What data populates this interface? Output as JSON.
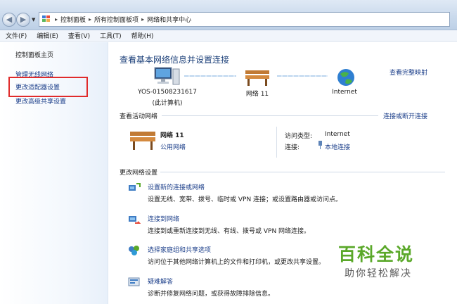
{
  "breadcrumb": {
    "items": [
      "控制面板",
      "所有控制面板项",
      "网络和共享中心"
    ],
    "icon": "control-panel-icon"
  },
  "menu": [
    "文件(F)",
    "编辑(E)",
    "查看(V)",
    "工具(T)",
    "帮助(H)"
  ],
  "sidebar": {
    "home": "控制面板主页",
    "items": [
      "管理无线网络",
      "更改适配器设置",
      "更改高级共享设置"
    ],
    "highlighted": "更改适配器设置",
    "highlight_color": "#e02b2b"
  },
  "main": {
    "title": "查看基本网络信息并设置连接",
    "full_map_link": "查看完整映射",
    "map": {
      "computer_name": "YOS-01508231617",
      "computer_sub": "(此计算机)",
      "network_name": "网络  11",
      "internet": "Internet"
    },
    "active_networks": {
      "heading": "查看活动网络",
      "disconnect_link": "连接或断开连接",
      "name": "网络  11",
      "type": "公用网络",
      "access_type_label": "访问类型:",
      "access_type_value": "Internet",
      "connections_label": "连接:",
      "connections_value": "本地连接"
    },
    "change_settings": {
      "heading": "更改网络设置",
      "tasks": [
        {
          "link": "设置新的连接或网络",
          "desc": "设置无线、宽带、拨号、临时或 VPN 连接；或设置路由器或访问点。"
        },
        {
          "link": "连接到网络",
          "desc": "连接到或重新连接到无线、有线、拨号或 VPN 网络连接。"
        },
        {
          "link": "选择家庭组和共享选项",
          "desc": "访问位于其他网络计算机上的文件和打印机，或更改共享设置。"
        },
        {
          "link": "疑难解答",
          "desc": "诊断并修复网络问题，或获得故障排除信息。"
        }
      ]
    }
  },
  "watermark": {
    "title": "百科全说",
    "subtitle": "助你轻松解决"
  },
  "colors": {
    "link": "#1c3f8a",
    "title": "#1a3e78",
    "watermark": "#5aa829"
  }
}
